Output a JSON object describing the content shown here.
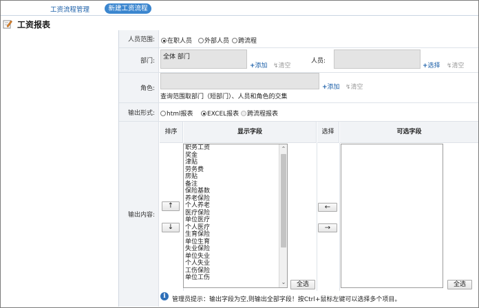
{
  "nav": {
    "tab_manage": "工资流程管理",
    "tab_new": "新建工资流程"
  },
  "page": {
    "title": "工资报表"
  },
  "form": {
    "scope": {
      "label": "人员范围:",
      "options": [
        "在职人员",
        "外部人员",
        "跨流程"
      ],
      "selected": "在职人员"
    },
    "dept": {
      "label": "部门:",
      "value": "全体 部门",
      "add": "添加",
      "clear": "清空"
    },
    "person": {
      "label": "人员:",
      "select": "选择",
      "clear": "清空"
    },
    "role": {
      "label": "角色:",
      "add": "添加",
      "clear": "清空",
      "hint": "查询范围取部门（短部门）、人员和角色的交集"
    },
    "output_format": {
      "label": "输出形式:",
      "options": [
        "html报表",
        "EXCEL报表",
        "跨流程报表"
      ],
      "selected": "EXCEL报表"
    },
    "output_content": {
      "label": "输出内容:",
      "col_sort": "排序",
      "col_display": "显示字段",
      "col_select": "选择",
      "col_available": "可选字段",
      "up_arrow": "↑",
      "down_arrow": "↓",
      "move_left": "←",
      "move_right": "→",
      "select_all": "全选",
      "display_fields": [
        "职务工资",
        "奖金",
        "津贴",
        "劳务费",
        "房贴",
        "备注",
        "保险基数",
        "养老保险",
        "个人养老",
        "医疗保险",
        "单位医疗",
        "个人医疗",
        "生育保险",
        "单位生育",
        "失业保险",
        "单位失业",
        "个人失业",
        "工伤保险",
        "单位工伤"
      ],
      "available_fields": []
    },
    "admin_tip": "管理员提示：输出字段为空,则输出全部字段！按Ctrl+鼠标左键可以选择多个项目。"
  }
}
